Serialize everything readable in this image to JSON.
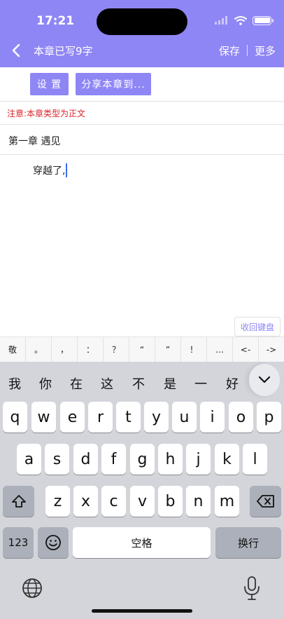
{
  "status_bar": {
    "time": "17:21"
  },
  "nav": {
    "title": "本章已写9字",
    "save_label": "保存",
    "more_label": "更多"
  },
  "toolbar": {
    "settings_label": "设 置",
    "share_label": "分享本章到..."
  },
  "notice": "注意:本章类型为正文",
  "chapter": {
    "title": "第一章 遇见",
    "body": "穿越了,"
  },
  "collapse_keyboard_label": "收回键盘",
  "punctuation": [
    "敬",
    "。",
    "，",
    "：",
    "？",
    "“",
    "”",
    "！",
    "…",
    "<-",
    "->"
  ],
  "candidates": [
    "我",
    "你",
    "在",
    "这",
    "不",
    "是",
    "一",
    "好"
  ],
  "keyboard": {
    "row1": [
      "q",
      "w",
      "e",
      "r",
      "t",
      "y",
      "u",
      "i",
      "o",
      "p"
    ],
    "row2": [
      "a",
      "s",
      "d",
      "f",
      "g",
      "h",
      "j",
      "k",
      "l"
    ],
    "row3": [
      "z",
      "x",
      "c",
      "v",
      "b",
      "n",
      "m"
    ],
    "numbers_label": "123",
    "space_label": "空格",
    "return_label": "换行"
  },
  "icons": [
    "back-chevron-icon",
    "signal-icon",
    "wifi-icon",
    "battery-icon",
    "chevron-down-icon",
    "shift-icon",
    "delete-icon",
    "emoji-icon",
    "globe-icon",
    "microphone-icon"
  ],
  "colors": {
    "accent": "#8f86f5",
    "notice": "#d9262b",
    "caret": "#3a6cf0",
    "keyboard_bg": "#d3d5db"
  }
}
